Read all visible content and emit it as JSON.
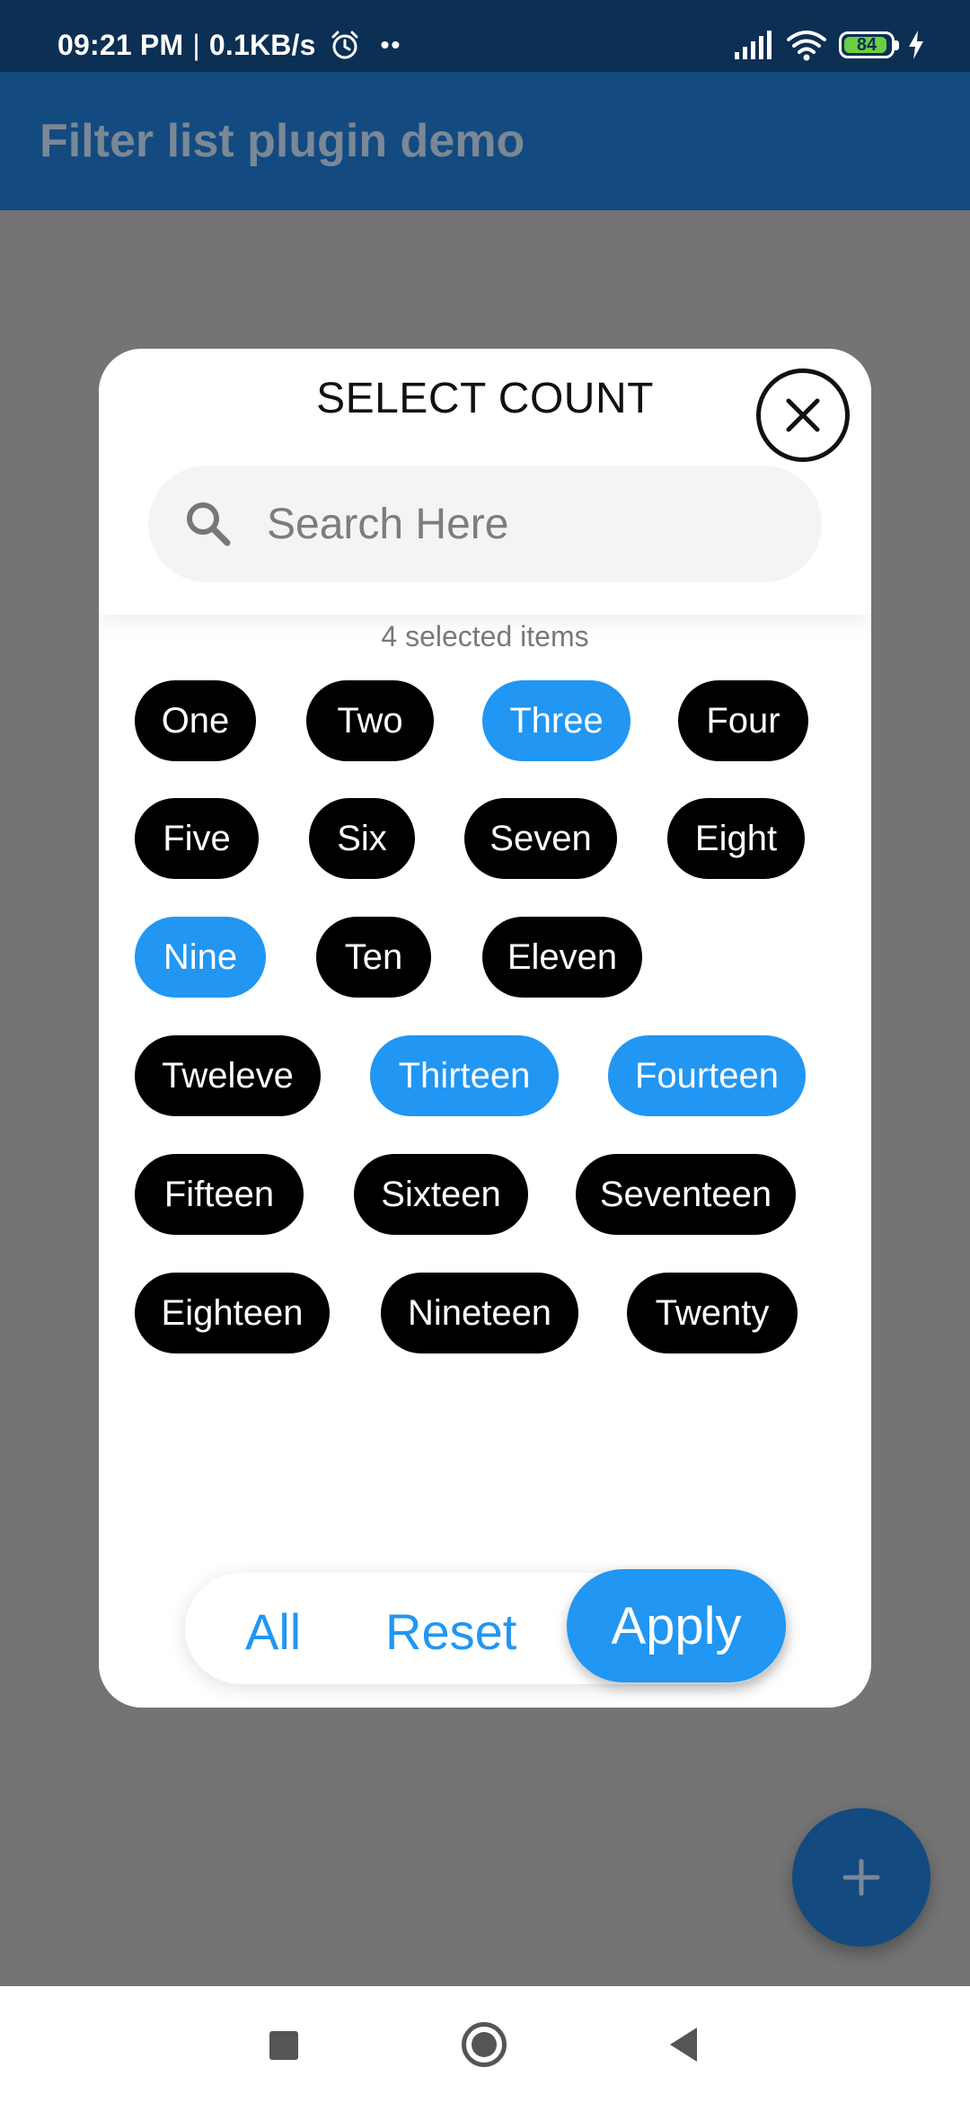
{
  "status_bar": {
    "time": "09:21 PM",
    "separator": "|",
    "speed": "0.1KB/s",
    "dots": "••",
    "battery": "84"
  },
  "app_bar": {
    "title": "Filter list plugin demo"
  },
  "dialog": {
    "title": "SELECT COUNT",
    "search": {
      "placeholder": "Search Here",
      "value": ""
    },
    "selected_text": "4 selected items",
    "chips": [
      {
        "label": "One",
        "selected": false
      },
      {
        "label": "Two",
        "selected": false
      },
      {
        "label": "Three",
        "selected": true
      },
      {
        "label": "Four",
        "selected": false
      },
      {
        "label": "Five",
        "selected": false
      },
      {
        "label": "Six",
        "selected": false
      },
      {
        "label": "Seven",
        "selected": false
      },
      {
        "label": "Eight",
        "selected": false
      },
      {
        "label": "Nine",
        "selected": true
      },
      {
        "label": "Ten",
        "selected": false
      },
      {
        "label": "Eleven",
        "selected": false
      },
      {
        "label": "Tweleve",
        "selected": false
      },
      {
        "label": "Thirteen",
        "selected": true
      },
      {
        "label": "Fourteen",
        "selected": true
      },
      {
        "label": "Fifteen",
        "selected": false
      },
      {
        "label": "Sixteen",
        "selected": false
      },
      {
        "label": "Seventeen",
        "selected": false
      },
      {
        "label": "Eighteen",
        "selected": false
      },
      {
        "label": "Nineteen",
        "selected": false
      },
      {
        "label": "Twenty",
        "selected": false
      }
    ],
    "actions": {
      "all": "All",
      "reset": "Reset",
      "apply": "Apply"
    }
  },
  "fab": {
    "icon": "plus-icon"
  },
  "colors": {
    "accent": "#2196f3",
    "chip_default": "#000000",
    "app_bar": "#134a80",
    "status_bar": "#0c2f54",
    "scrim": "#747474"
  }
}
